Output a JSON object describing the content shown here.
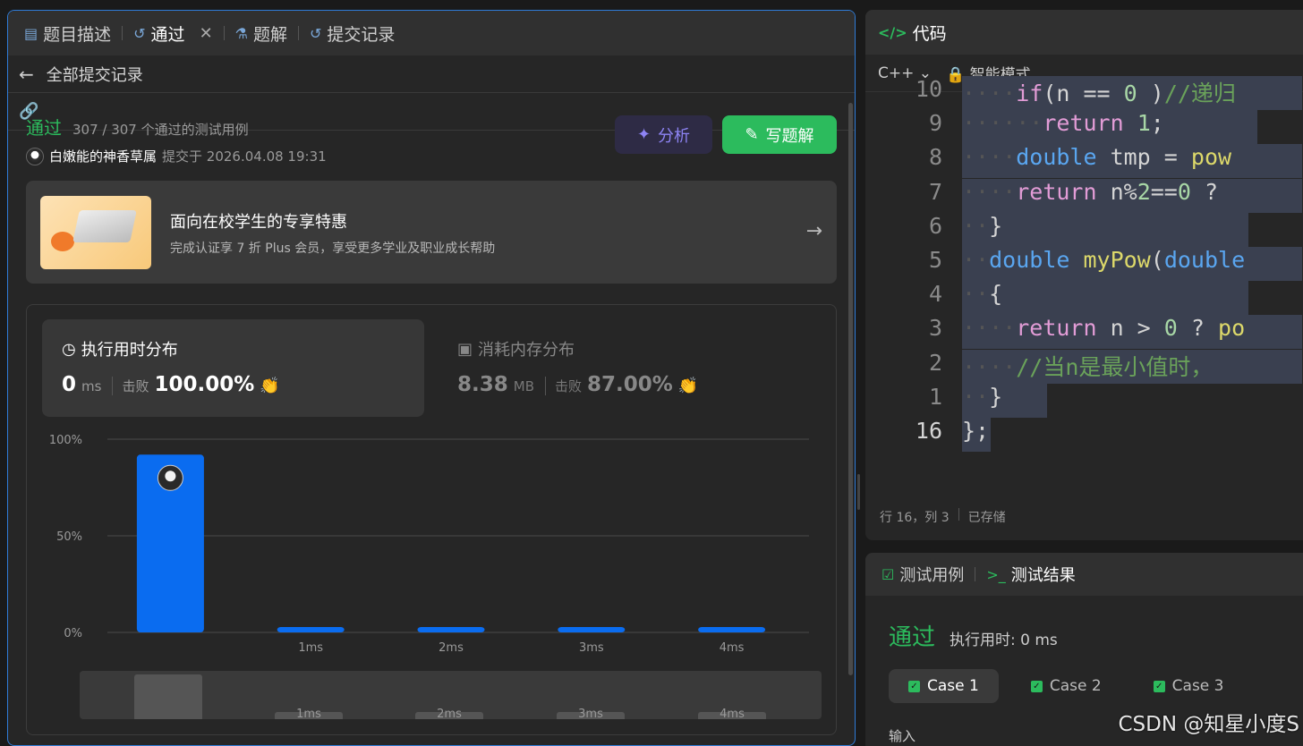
{
  "tabs": {
    "description": "题目描述",
    "passed": "通过",
    "solutions": "题解",
    "submissions": "提交记录"
  },
  "subheader": {
    "title": "全部提交记录"
  },
  "submission": {
    "status": "通过",
    "testcases": "307 / 307 个通过的测试用例",
    "user": "白嫩能的神香草属",
    "submitted_at": "提交于 2026.04.08 19:31"
  },
  "buttons": {
    "analyze": "分析",
    "write_solution": "写题解"
  },
  "promo": {
    "title": "面向在校学生的专享特惠",
    "subtitle": "完成认证享 7 折 Plus 会员，享受更多学业及职业成长帮助"
  },
  "runtime": {
    "title": "执行用时分布",
    "value": "0",
    "unit": "ms",
    "beat_label": "击败",
    "beat_value": "100.00%"
  },
  "memory": {
    "title": "消耗内存分布",
    "value": "8.38",
    "unit": "MB",
    "beat_label": "击败",
    "beat_value": "87.00%"
  },
  "chart_data": {
    "type": "bar",
    "categories": [
      "",
      "1ms",
      "2ms",
      "3ms",
      "4ms"
    ],
    "values": [
      92,
      2,
      2,
      2,
      2
    ],
    "ylim": [
      0,
      100
    ],
    "yticks": [
      "100%",
      "50%",
      "0%"
    ],
    "grid": true,
    "colors": {
      "bar": "#0a6cf0",
      "grid": "#4a4a4a"
    }
  },
  "minimap": {
    "labels": [
      "1ms",
      "2ms",
      "3ms",
      "4ms"
    ]
  },
  "editor": {
    "title": "代码",
    "language": "C++",
    "mode": "智能模式",
    "footer_position": "行 16，列 3",
    "footer_saved": "已存储"
  },
  "code_lines": [
    {
      "ln": "10",
      "text": "if(n == 0 )//递归"
    },
    {
      "ln": "9",
      "text": "return 1;"
    },
    {
      "ln": "8",
      "text": "double tmp = pow"
    },
    {
      "ln": "7",
      "text": "return n%2==0 ? "
    },
    {
      "ln": "6",
      "text": "}"
    },
    {
      "ln": "5",
      "text": "double myPow(double "
    },
    {
      "ln": "4",
      "text": "{"
    },
    {
      "ln": "3",
      "text": "return n > 0 ? po"
    },
    {
      "ln": "2",
      "text": "//当n是最小值时，"
    },
    {
      "ln": "1",
      "text": "}"
    },
    {
      "ln": "16",
      "text": "};"
    }
  ],
  "results": {
    "tab_testcase": "测试用例",
    "tab_result": "测试结果",
    "status": "通过",
    "runtime": "执行用时: 0 ms",
    "cases": [
      "Case 1",
      "Case 2",
      "Case 3"
    ],
    "input_label": "输入"
  },
  "watermark": "CSDN @知星小度S"
}
